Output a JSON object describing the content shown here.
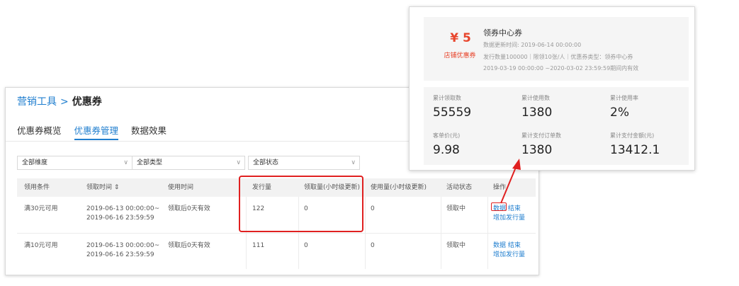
{
  "breadcrumb": {
    "parent": "营销工具",
    "separator": ">",
    "current": "优惠券"
  },
  "tabs": [
    {
      "label": "优惠券概览"
    },
    {
      "label": "优惠券管理",
      "active": true
    },
    {
      "label": "数据效果"
    }
  ],
  "filters": [
    {
      "value": "全部维度"
    },
    {
      "value": "全部类型"
    },
    {
      "value": "全部状态"
    }
  ],
  "table": {
    "headers": [
      "领用条件",
      "领取时间 ⇕",
      "使用时间",
      "发行量",
      "领取量(小时级更新)",
      "使用量(小时级更新)",
      "活动状态",
      "操作"
    ],
    "rows": [
      {
        "condition": "满30元可用",
        "time_start": "2019-06-13 00:00:00~",
        "time_end": "2019-06-16 23:59:59",
        "usage": "领取后0天有效",
        "issued": "122",
        "claimed": "0",
        "used": "0",
        "status": "领取中",
        "op_data": "数据",
        "op_end": "结束",
        "op_add": "增加发行量"
      },
      {
        "condition": "满10元可用",
        "time_start": "2019-06-13 00:00:00~",
        "time_end": "2019-06-16 23:59:59",
        "usage": "领取后0天有效",
        "issued": "111",
        "claimed": "0",
        "used": "0",
        "status": "领取中",
        "op_data": "数据",
        "op_end": "结束",
        "op_add": "增加发行量"
      }
    ]
  },
  "popup": {
    "coupon": {
      "amount": "¥ 5",
      "type": "店铺优惠券",
      "title": "领券中心券",
      "update_time": "数据更新时间: 2019-06-14 00:00:00",
      "meta": "发行数量100000｜限领10张/人｜优惠券类型：领券中心券",
      "validity": "2019-03-19 00:00:00 ~2020-03-02 23:59:59期间内有效"
    },
    "stats": [
      {
        "label": "累计领取数",
        "value": "55559"
      },
      {
        "label": "累计使用数",
        "value": "1380"
      },
      {
        "label": "累计使用率",
        "value": "2%"
      },
      {
        "label": "客单价(元)",
        "value": "9.98"
      },
      {
        "label": "累计支付订单数",
        "value": "1380"
      },
      {
        "label": "累计支付金额(元)",
        "value": "13412.1"
      }
    ]
  },
  "colors": {
    "accent": "#1f7ecf",
    "highlight": "#e02020",
    "coupon_red": "#e8452c"
  }
}
